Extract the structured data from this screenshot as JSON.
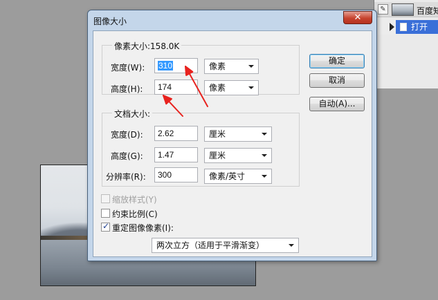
{
  "layers_panel": {
    "layer_name": "百度知",
    "open_label": "打开"
  },
  "dialog": {
    "title": "图像大小",
    "close_glyph": "✕",
    "pixel_dimensions": {
      "legend": "像素大小:158.0K",
      "width_label": "宽度(W):",
      "width_value": "310",
      "width_unit": "像素",
      "height_label": "高度(H):",
      "height_value": "174",
      "height_unit": "像素"
    },
    "document_size": {
      "legend": "文档大小:",
      "width_label": "宽度(D):",
      "width_value": "2.62",
      "width_unit": "厘米",
      "height_label": "高度(G):",
      "height_value": "1.47",
      "height_unit": "厘米",
      "resolution_label": "分辨率(R):",
      "resolution_value": "300",
      "resolution_unit": "像素/英寸"
    },
    "buttons": {
      "ok": "确定",
      "cancel": "取消",
      "auto": "自动(A)..."
    },
    "options": {
      "scale_styles": {
        "label": "缩放样式(Y)",
        "checked": false,
        "enabled": false
      },
      "constrain": {
        "label": "约束比例(C)",
        "checked": false,
        "enabled": true
      },
      "resample": {
        "label": "重定图像像素(I):",
        "checked": true,
        "enabled": true
      },
      "resample_method": "两次立方（适用于平滑渐变）"
    },
    "annotation_color": "#e8231f"
  }
}
